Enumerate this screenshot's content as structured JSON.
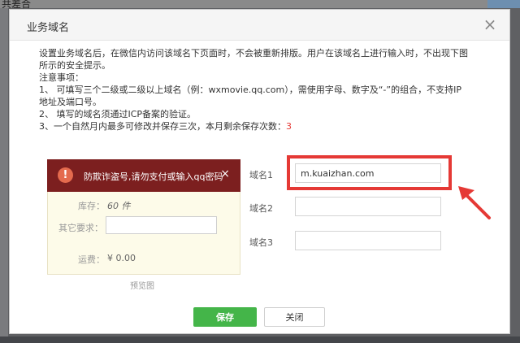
{
  "background": {
    "top_label": "共差合"
  },
  "dialog": {
    "title": "业务域名",
    "close_symbol": "×"
  },
  "notice": {
    "intro": "设置业务域名后，在微信内访问该域名下页面时，不会被重新排版。用户在该域名上进行输入时，不出现下图所示的安全提示。",
    "heading": "注意事项：",
    "item1": "1、 可填写三个二级或二级以上域名（例：wxmovie.qq.com），需使用字母、数字及“-”的组合，不支持IP地址及端口号。",
    "item2": "2、 填写的域名须通过ICP备案的验证。",
    "item3_prefix": "3、一个自然月内最多可修改并保存三次，本月剩余保存次数：",
    "remaining_count": "3"
  },
  "preview": {
    "warning_text": "防欺诈盗号,请勿支付或输入qq密码",
    "warning_icon": "!",
    "warning_close": "×",
    "stock_label": "库存：",
    "stock_value": "60 件",
    "other_label": "其它要求：",
    "shipping_label": "运费：",
    "shipping_value": "¥ 0.00",
    "caption": "预览图"
  },
  "domains": [
    {
      "label": "域名1",
      "value": "m.kuaizhan.com"
    },
    {
      "label": "域名2",
      "value": ""
    },
    {
      "label": "域名3",
      "value": ""
    }
  ],
  "buttons": {
    "save": "保存",
    "close": "关闭"
  },
  "colors": {
    "accent_red": "#e53935",
    "save_green": "#44b549",
    "warning_banner": "#7c1f1f"
  }
}
